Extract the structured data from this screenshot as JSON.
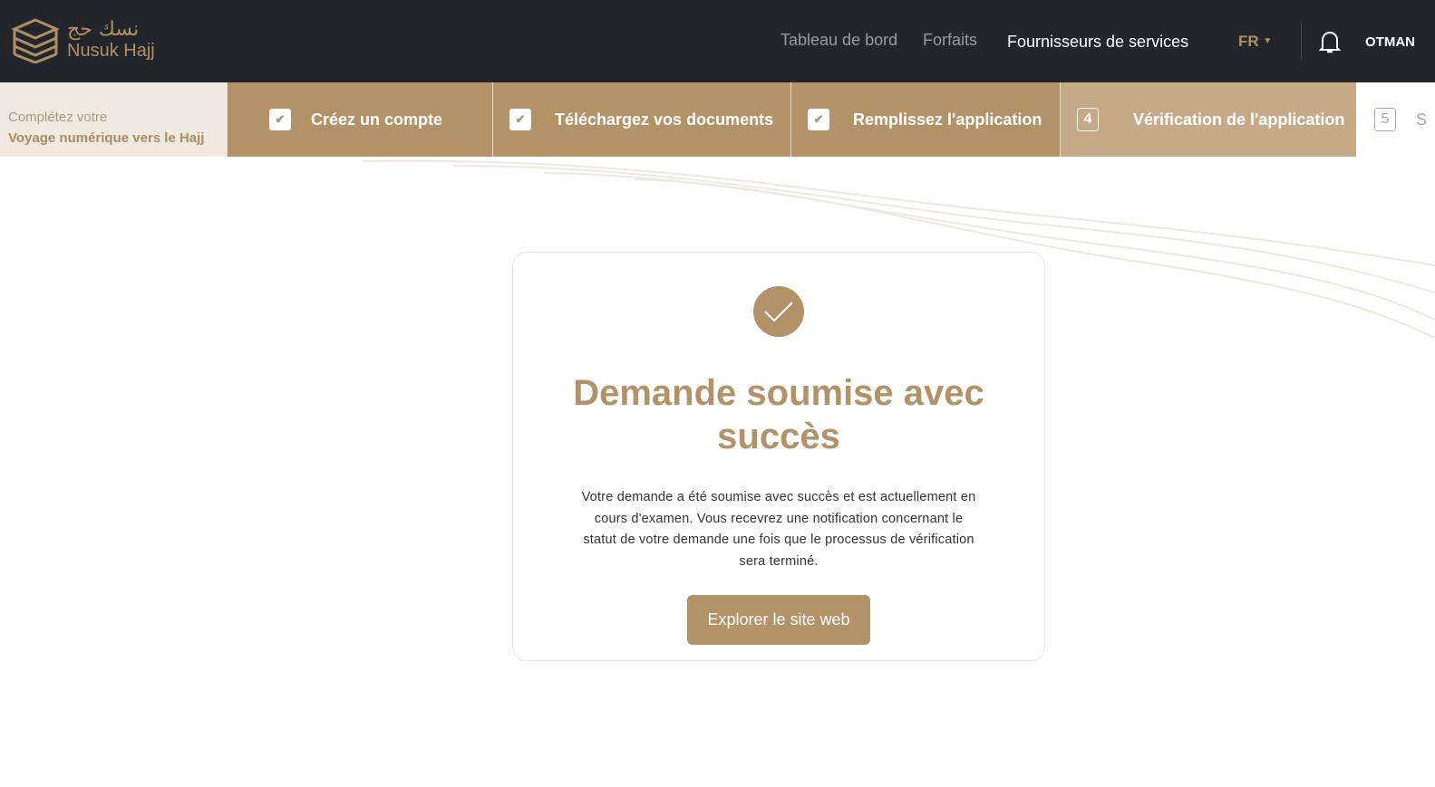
{
  "header": {
    "logo_ar": "نسك حج",
    "logo_en": "Nusuk Hajj",
    "nav": [
      "Tableau de bord",
      "Forfaits",
      "Fournisseurs de services"
    ],
    "language": "FR",
    "user": "OTMAN"
  },
  "steps": {
    "intro_line1": "Complétez votre",
    "intro_line2": "Voyage numérique vers le Hajj",
    "items": [
      {
        "label": "Créez un compte",
        "status": "done"
      },
      {
        "label": "Téléchargez vos documents",
        "status": "done"
      },
      {
        "label": "Remplissez l'application",
        "status": "done"
      },
      {
        "number": "4",
        "label": "Vérification de l'application",
        "status": "current"
      },
      {
        "number": "5",
        "label": "S",
        "status": "upcoming"
      }
    ]
  },
  "card": {
    "title": "Demande soumise avec succès",
    "description": "Votre demande a été soumise avec succès et est actuellement en cours d'examen. Vous recevrez une notification concernant le statut de votre demande une fois que le processus de vérification sera terminé.",
    "button": "Explorer le site web"
  },
  "colors": {
    "accent": "#b39268",
    "header_bg": "#22262b"
  }
}
